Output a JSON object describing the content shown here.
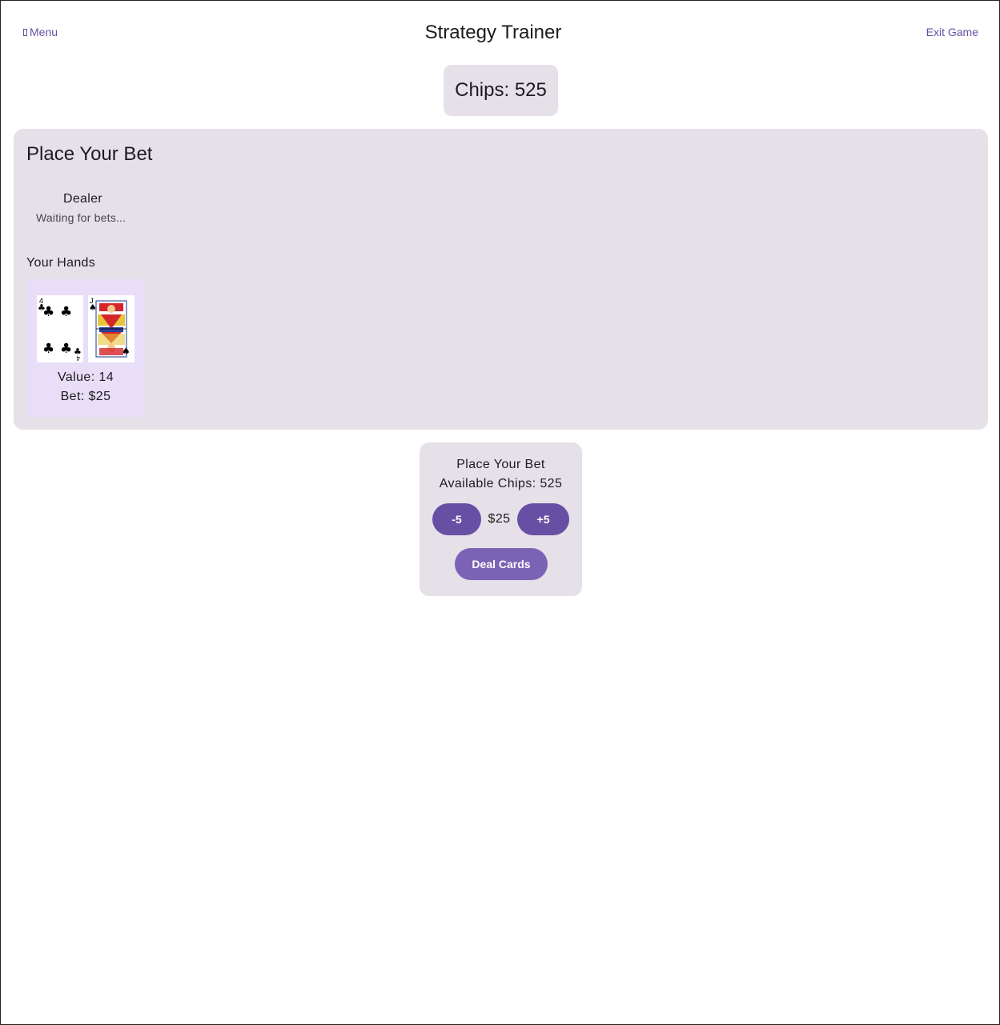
{
  "header": {
    "menu_label": "Menu",
    "title": "Strategy Trainer",
    "exit_label": "Exit Game"
  },
  "chips": {
    "label": "Chips: 525"
  },
  "table": {
    "title": "Place Your Bet",
    "dealer": {
      "label": "Dealer",
      "status": "Waiting for bets..."
    },
    "hands_label": "Your Hands",
    "hands": [
      {
        "cards": [
          {
            "rank": "4",
            "suit": "clubs"
          },
          {
            "rank": "J",
            "suit": "spades"
          }
        ],
        "value": "Value: 14",
        "bet": "Bet: $25"
      }
    ]
  },
  "betting": {
    "title": "Place Your Bet",
    "available": "Available Chips: 525",
    "decrease_label": "-5",
    "amount": "$25",
    "increase_label": "+5",
    "deal_label": "Deal Cards"
  },
  "colors": {
    "accent": "#6750a4",
    "panel": "#e6e0e9",
    "hand_bg": "#e8def8"
  }
}
